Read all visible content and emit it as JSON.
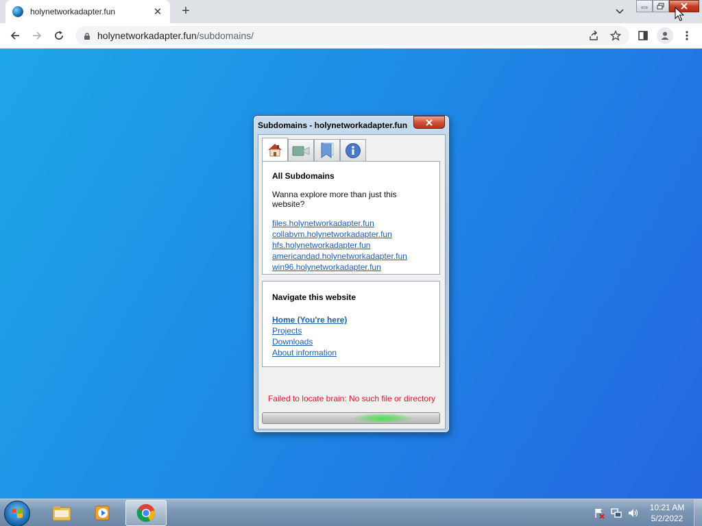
{
  "browser": {
    "tab_title": "holynetworkadapter.fun",
    "tab_close": "✕",
    "new_tab": "+",
    "url_host": "holynetworkadapter.fun",
    "url_path": "/subdomains/"
  },
  "dialog": {
    "title": "Subdomains - holynetworkadapter.fun",
    "close_label": "✕",
    "tabs": [
      "home-icon",
      "video-icon",
      "bookmark-icon",
      "info-icon"
    ],
    "subdomains": {
      "heading": "All Subdomains",
      "intro": "Wanna explore more than just this website?",
      "links": [
        "files.holynetworkadapter.fun",
        "collabvm.holynetworkadapter.fun",
        "hfs.holynetworkadapter.fun",
        "americandad.holynetworkadapter.fun",
        "win96.holynetworkadapter.fun"
      ]
    },
    "navigate": {
      "heading": "Navigate this website",
      "links": [
        "Home (You're here)",
        "Projects",
        "Downloads",
        "About information"
      ]
    },
    "error_text": "Failed to locate brain: No such file or directory",
    "accent_color": "#e0162b"
  },
  "taskbar": {
    "time": "10:21 AM",
    "date": "5/2/2022"
  }
}
